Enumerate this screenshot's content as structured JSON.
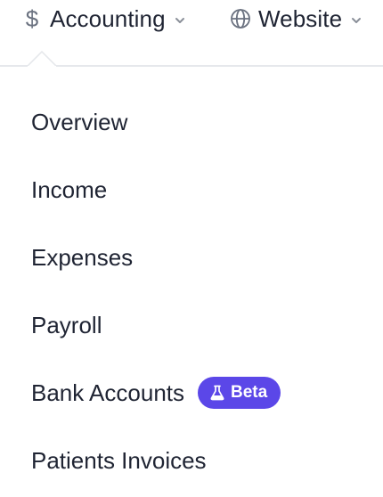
{
  "topnav": {
    "accounting": {
      "icon": "dollar-icon",
      "symbol": "$",
      "label": "Accounting"
    },
    "website": {
      "icon": "globe-icon",
      "label": "Website"
    }
  },
  "menu": {
    "items": [
      {
        "label": "Overview"
      },
      {
        "label": "Income"
      },
      {
        "label": "Expenses"
      },
      {
        "label": "Payroll"
      },
      {
        "label": "Bank Accounts",
        "badge": "Beta",
        "badge_icon": "flask-icon"
      },
      {
        "label": "Patients Invoices"
      }
    ]
  },
  "colors": {
    "text": "#1f2433",
    "icon_gray": "#6b7280",
    "divider": "#e6e8ec",
    "badge_bg": "#5b47e8",
    "badge_text": "#ffffff"
  }
}
